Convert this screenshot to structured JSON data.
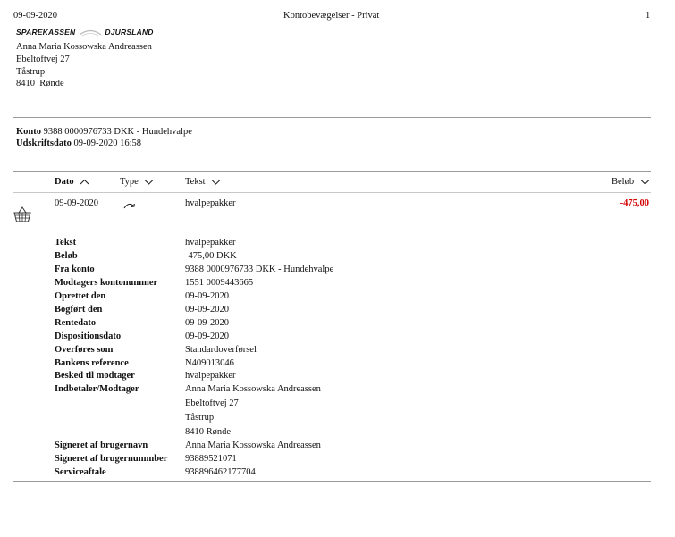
{
  "page_header": {
    "date": "09-09-2020",
    "title": "Kontobevægelser - Privat",
    "page_number": "1"
  },
  "bank": {
    "name_left": "SPAREKASSEN",
    "name_right": "DJURSLAND"
  },
  "address": {
    "name": "Anna Maria Kossowska Andreassen",
    "street": "Ebeltoftvej 27",
    "area": "Tåstrup",
    "postcode": "8410",
    "city": "Rønde"
  },
  "account_info": {
    "konto_label": "Konto",
    "konto_value": "9388 0000976733 DKK - Hundehvalpe",
    "udskrift_label": "Udskriftsdato",
    "udskrift_value": "09-09-2020 16:58"
  },
  "table": {
    "headers": {
      "dato": "Dato",
      "type": "Type",
      "tekst": "Tekst",
      "belob": "Beløb"
    },
    "row": {
      "dato": "09-09-2020",
      "tekst": "hvalpepakker",
      "belob": "-475,00",
      "category_icon": "basket-icon",
      "type_icon": "curved-arrow-icon",
      "amount_color": "#d40000"
    }
  },
  "details": [
    {
      "label": "Tekst",
      "value": "hvalpepakker"
    },
    {
      "label": "Beløb",
      "value": "-475,00 DKK"
    },
    {
      "label": "Fra konto",
      "value": "9388 0000976733 DKK - Hundehvalpe"
    },
    {
      "label": "Modtagers kontonummer",
      "value": "1551 0009443665"
    },
    {
      "label": "Oprettet den",
      "value": "09-09-2020"
    },
    {
      "label": "Bogført den",
      "value": "09-09-2020"
    },
    {
      "label": "Rentedato",
      "value": "09-09-2020"
    },
    {
      "label": "Dispositionsdato",
      "value": "09-09-2020"
    },
    {
      "label": "Overføres som",
      "value": "Standardoverførsel"
    },
    {
      "label": "Bankens reference",
      "value": "N409013046"
    },
    {
      "label": "Besked til modtager",
      "value": "hvalpepakker"
    },
    {
      "label": "Indbetaler/Modtager",
      "value": "Anna Maria Kossowska Andreassen"
    }
  ],
  "payer_address": {
    "street": "Ebeltoftvej 27",
    "area": "Tåstrup",
    "postal": "8410 Rønde"
  },
  "signatures": [
    {
      "label": "Signeret af brugernavn",
      "value": "Anna Maria Kossowska Andreassen"
    },
    {
      "label": "Signeret af brugernummber",
      "value": "93889521071"
    },
    {
      "label": "Serviceaftale",
      "value": "938896462177704"
    }
  ]
}
